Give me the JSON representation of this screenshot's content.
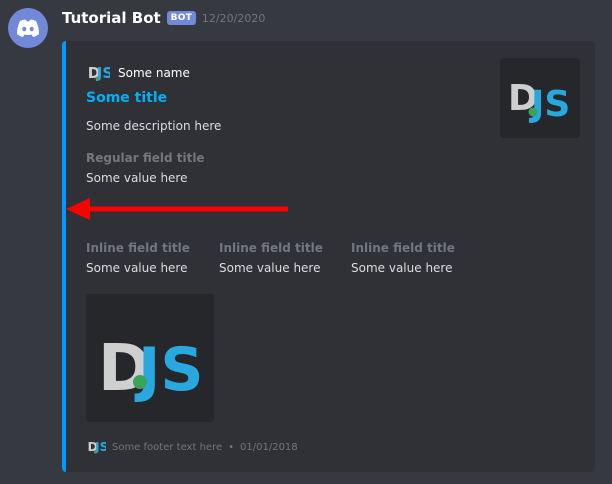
{
  "message": {
    "username": "Tutorial Bot",
    "bot_tag": "BOT",
    "timestamp": "12/20/2020"
  },
  "embed": {
    "accent_color": "#0099ff",
    "author": {
      "name": "Some name",
      "icon": "djs-logo"
    },
    "title": "Some title",
    "description": "Some description here",
    "thumbnail": {
      "icon": "djs-logo"
    },
    "fields": [
      {
        "name": "Regular field title",
        "value": "Some value here",
        "inline": false
      },
      {
        "name": "Inline field title",
        "value": "Some value here",
        "inline": true
      },
      {
        "name": "Inline field title",
        "value": "Some value here",
        "inline": true
      },
      {
        "name": "Inline field title",
        "value": "Some value here",
        "inline": true
      }
    ],
    "image": {
      "icon": "djs-logo"
    },
    "footer": {
      "text": "Some footer text here",
      "separator": "•",
      "timestamp": "01/01/2018",
      "icon": "djs-logo"
    }
  },
  "annotation": {
    "icon": "red-arrow-left",
    "color": "#ff0000"
  }
}
